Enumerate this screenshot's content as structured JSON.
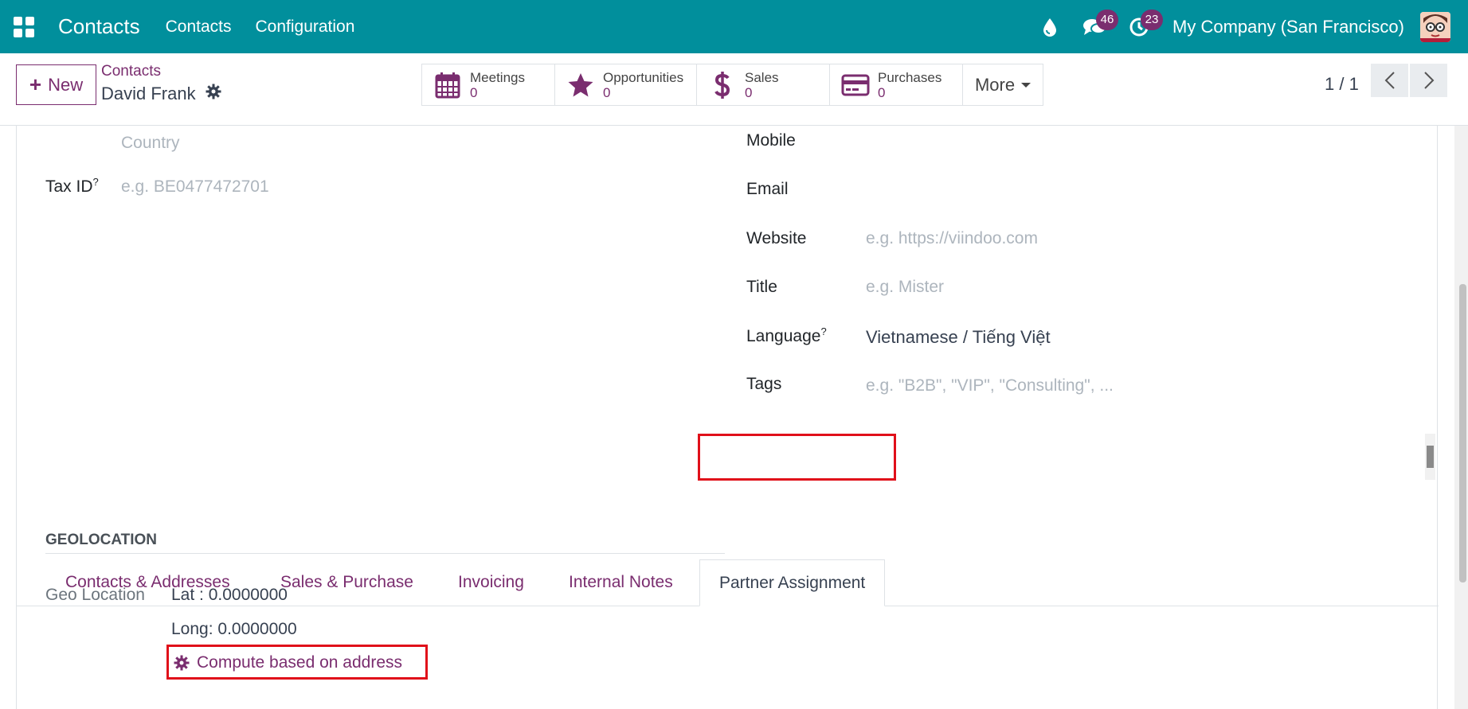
{
  "theme": {
    "nav_bg": "#018f9c",
    "accent": "#7a2d6f",
    "highlight": "#e0101a"
  },
  "navbar": {
    "apps_icon": "apps-grid-icon",
    "brand": "Contacts",
    "menus": [
      "Contacts",
      "Configuration"
    ],
    "icons": [
      {
        "name": "droplet-icon",
        "badge": ""
      },
      {
        "name": "chat-icon",
        "badge": "46"
      },
      {
        "name": "activity-clock-icon",
        "badge": "23"
      }
    ],
    "company": "My Company (San Francisco)"
  },
  "control": {
    "new_label": "New",
    "breadcrumb": "Contacts",
    "record_name": "David Frank",
    "smart_buttons": [
      {
        "label": "Meetings",
        "value": "0",
        "icon": "calendar-icon"
      },
      {
        "label": "Opportunities",
        "value": "0",
        "icon": "star-icon"
      },
      {
        "label": "Sales",
        "value": "0",
        "icon": "dollar-icon"
      },
      {
        "label": "Purchases",
        "value": "0",
        "icon": "credit-card-icon"
      }
    ],
    "more_label": "More",
    "pager": "1 / 1"
  },
  "form": {
    "country_placeholder": "Country",
    "tax_id_label": "Tax ID",
    "tax_id_help": "?",
    "tax_id_placeholder": "e.g. BE0477472701",
    "mobile_label": "Mobile",
    "email_label": "Email",
    "website_label": "Website",
    "website_placeholder": "e.g. https://viindoo.com",
    "title_label": "Title",
    "title_placeholder": "e.g. Mister",
    "language_label": "Language",
    "language_help": "?",
    "language_value": "Vietnamese / Tiếng Việt",
    "tags_label": "Tags",
    "tags_placeholder": "e.g. \"B2B\", \"VIP\", \"Consulting\", ..."
  },
  "tabs": [
    "Contacts & Addresses",
    "Sales & Purchase",
    "Invoicing",
    "Internal Notes",
    "Partner Assignment"
  ],
  "geolocation": {
    "section_title": "GEOLOCATION",
    "label": "Geo Location",
    "lat": "Lat : 0.0000000",
    "long": "Long: 0.0000000",
    "compute_label": "Compute based on address"
  }
}
